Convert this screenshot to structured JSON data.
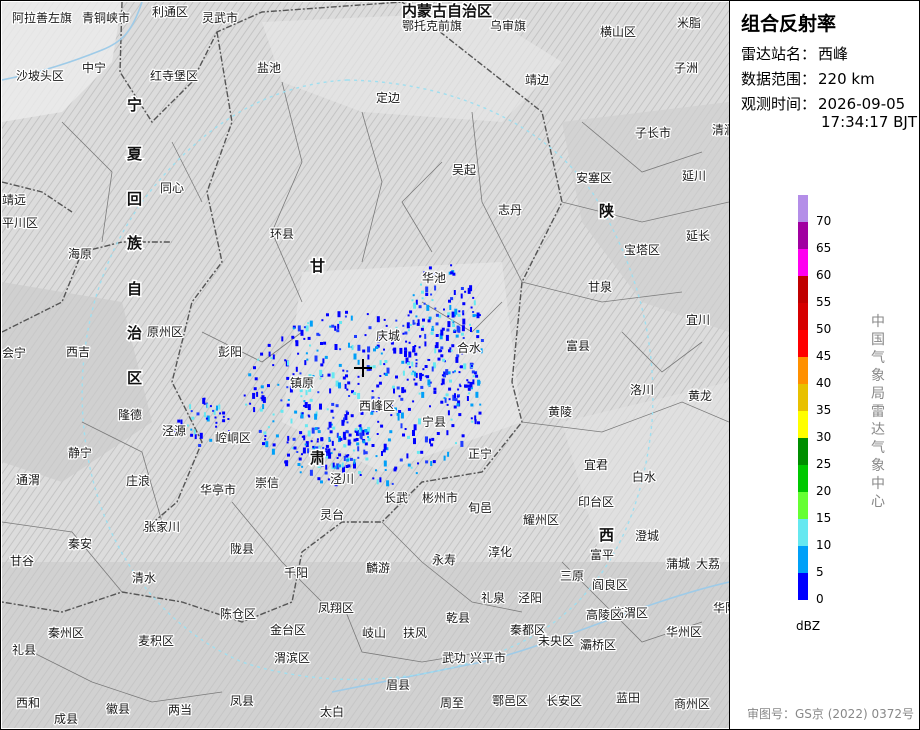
{
  "panel": {
    "title": "组合反射率",
    "station_label": "雷达站名：",
    "station_value": "西峰",
    "range_label": "数据范围：",
    "range_value": "220 km",
    "time_label": "观测时间：",
    "time_date": "2026-09-05",
    "time_clock": "17:34:17 BJT",
    "unit": "dBZ",
    "agency": "中国气象局雷达气象中心",
    "approval": "审图号：GS京 (2022) 0372号"
  },
  "colorbar": [
    {
      "label": "70",
      "color": "#b48ee8"
    },
    {
      "label": "65",
      "color": "#a100a1"
    },
    {
      "label": "60",
      "color": "#ff00f0"
    },
    {
      "label": "55",
      "color": "#c00000"
    },
    {
      "label": "50",
      "color": "#d60000"
    },
    {
      "label": "45",
      "color": "#ff0000"
    },
    {
      "label": "40",
      "color": "#ff9000"
    },
    {
      "label": "35",
      "color": "#e8c000"
    },
    {
      "label": "30",
      "color": "#ffff00"
    },
    {
      "label": "25",
      "color": "#008e00"
    },
    {
      "label": "20",
      "color": "#00c800"
    },
    {
      "label": "15",
      "color": "#66ff33"
    },
    {
      "label": "10",
      "color": "#66e8f0"
    },
    {
      "label": "5",
      "color": "#00a0f8"
    },
    {
      "label": "0",
      "color": "#0000ff"
    }
  ],
  "map": {
    "provinces": {
      "inner_mongolia": "内蒙古自治区",
      "ningxia": [
        "宁",
        "夏",
        "回",
        "族",
        "自",
        "治",
        "区"
      ],
      "gansu": [
        "甘",
        "肃"
      ],
      "shaanxi": [
        "陕",
        "西"
      ]
    },
    "places": [
      "阿拉善左旗",
      "青铜峡市",
      "利通区",
      "灵武市",
      "鄂托克前旗",
      "乌审旗",
      "横山区",
      "米脂",
      "沙坡头区",
      "中宁",
      "红寺堡区",
      "盐池",
      "靖边",
      "子洲",
      "定边",
      "子长市",
      "清涧",
      "同心",
      "吴起",
      "安塞区",
      "延川",
      "靖远",
      "平川区",
      "环县",
      "志丹",
      "海原",
      "宝塔区",
      "延长",
      "华池",
      "甘泉",
      "原州区",
      "庆城",
      "宜川",
      "会宁",
      "西吉",
      "彭阳",
      "合水",
      "富县",
      "镇原",
      "西峰区",
      "洛川",
      "黄龙",
      "隆德",
      "泾源",
      "崆峒区",
      "宁县",
      "黄陵",
      "静宁",
      "正宁",
      "宜君",
      "白水",
      "通渭",
      "庄浪",
      "华亭市",
      "崇信",
      "泾川",
      "长武",
      "彬州市",
      "旬邑",
      "印台区",
      "耀州区",
      "澄城",
      "张家川",
      "灵台",
      "淳化",
      "蒲城",
      "甘谷",
      "秦安",
      "陇县",
      "麟游",
      "永寿",
      "三原",
      "富平",
      "阎良区",
      "大荔",
      "清水",
      "千阳",
      "临渭区",
      "华阴",
      "凤翔区",
      "岐山",
      "扶风",
      "乾县",
      "礼泉",
      "泾阳",
      "高陵区",
      "华州区",
      "陈仓区",
      "武功",
      "兴平市",
      "秦都区",
      "未央区",
      "灞桥区",
      "秦州区",
      "麦积区",
      "金台区",
      "渭滨区",
      "周至",
      "鄠邑区",
      "长安区",
      "蓝田",
      "商州区",
      "礼县",
      "西和",
      "徽县",
      "两当",
      "凤县",
      "眉县",
      "太白",
      "成县"
    ]
  }
}
